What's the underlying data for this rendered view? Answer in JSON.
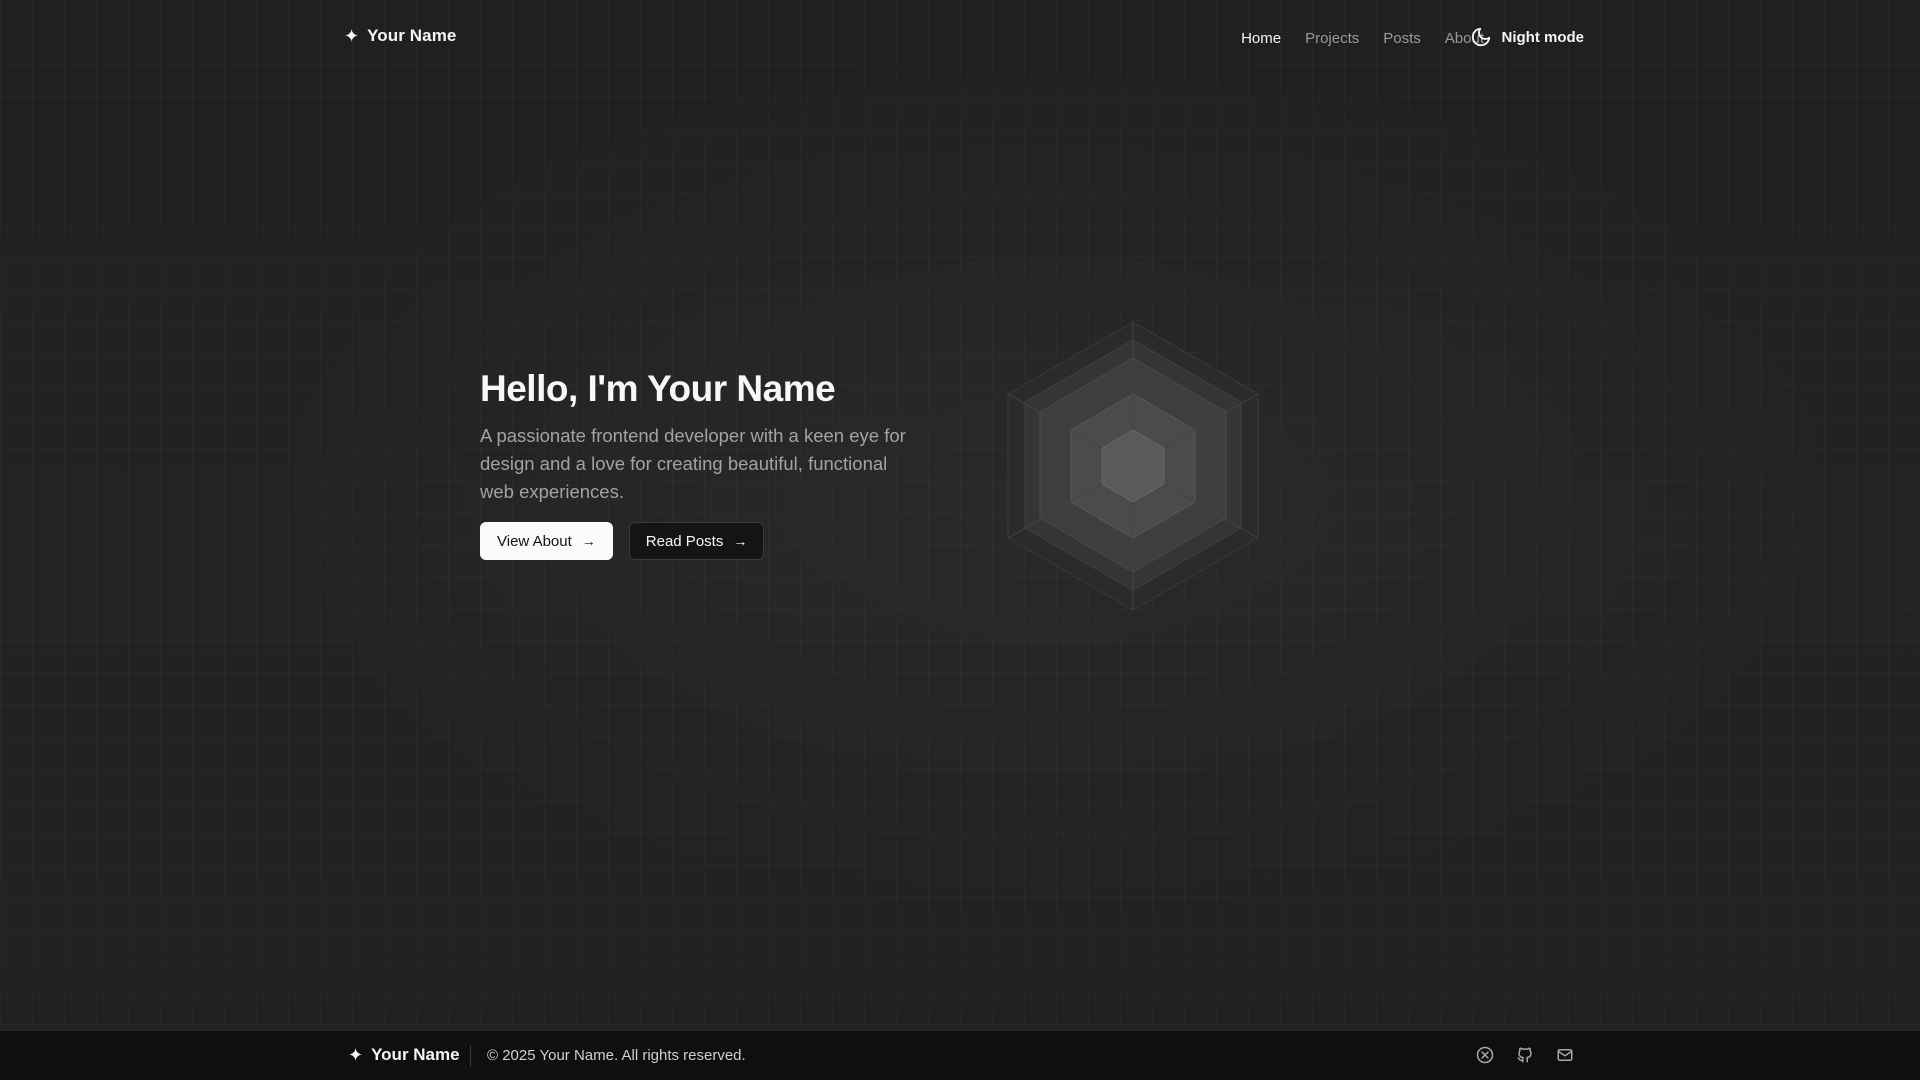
{
  "header": {
    "brand_star": "✦",
    "brand_name": "Your Name",
    "nav": {
      "home": "Home",
      "projects": "Projects",
      "posts": "Posts",
      "about": "About"
    },
    "theme_toggle_label": "Night mode",
    "theme_toggle_icon": "moon-icon"
  },
  "hero": {
    "title": "Hello, I'm Your Name",
    "subtitle": "A passionate frontend developer with a keen eye for design and a love for creating beautiful, functional web experiences.",
    "primary_button": "View About",
    "secondary_button": "Read Posts",
    "arrow_glyph": "→",
    "graphic_icon": "hexagon-graphic"
  },
  "footer": {
    "brand_star": "✦",
    "brand_name": "Your Name",
    "copyright": "© 2025 Your Name. All rights reserved.",
    "social_icons": [
      "x-icon",
      "github-icon",
      "mail-icon"
    ]
  },
  "colors": {
    "background": "#1f1f1f",
    "footer_background": "#0f0f0f",
    "text_primary": "#f5f5f5",
    "text_muted": "#9a9a9a",
    "button_primary_bg": "#fafafa",
    "button_secondary_bg": "#141414"
  }
}
